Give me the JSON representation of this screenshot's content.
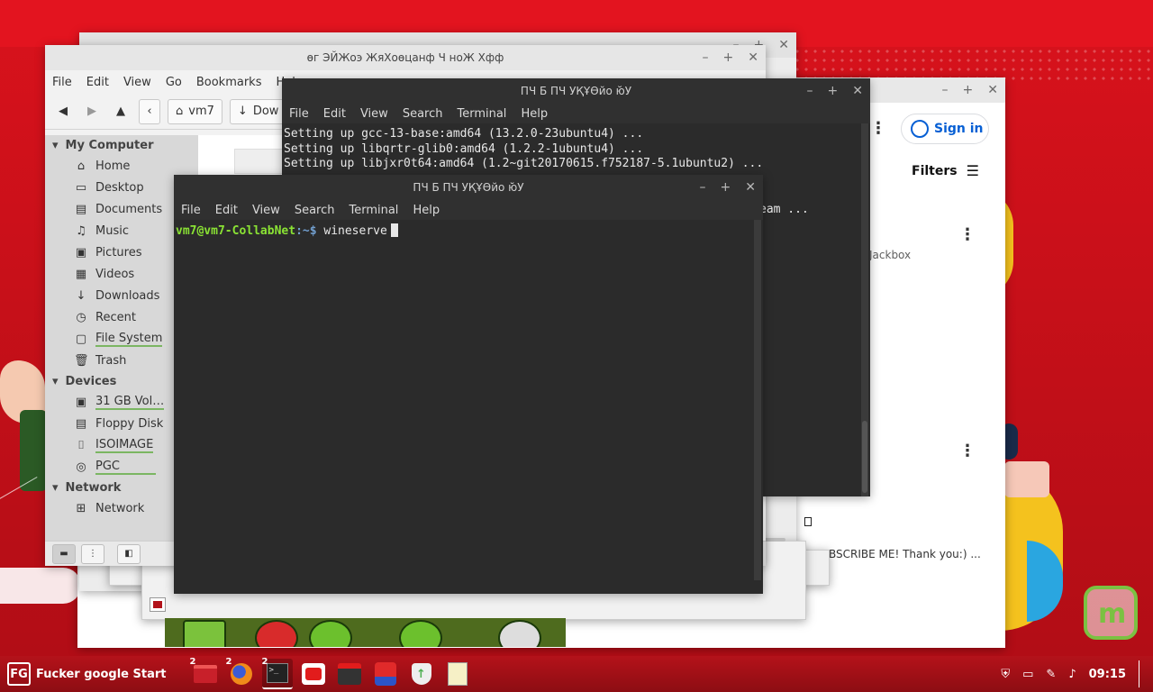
{
  "back_browser": {
    "sign_in": "Sign in",
    "filters": "Filters",
    "snippet_1": "Jackbox",
    "snippet_2": "BSCRIBE ME! Thank you:) ..."
  },
  "file_manager": {
    "title": "өг ЭЙЖоэ ЖяХоөцанф Ч ноЖ Хфф",
    "menu": [
      "File",
      "Edit",
      "View",
      "Go",
      "Bookmarks",
      "Help"
    ],
    "path_current": "vm7",
    "path_next": "Dow",
    "sidebar": {
      "my_computer": "My Computer",
      "computer_items": [
        {
          "label": "Home",
          "icon": "home-icon"
        },
        {
          "label": "Desktop",
          "icon": "desktop-icon"
        },
        {
          "label": "Documents",
          "icon": "documents-icon"
        },
        {
          "label": "Music",
          "icon": "music-icon"
        },
        {
          "label": "Pictures",
          "icon": "pictures-icon"
        },
        {
          "label": "Videos",
          "icon": "videos-icon"
        },
        {
          "label": "Downloads",
          "icon": "downloads-icon"
        },
        {
          "label": "Recent",
          "icon": "recent-icon"
        },
        {
          "label": "File System",
          "icon": "filesystem-icon"
        },
        {
          "label": "Trash",
          "icon": "trash-icon"
        }
      ],
      "devices": "Devices",
      "device_items": [
        {
          "label": "31 GB Vol…",
          "icon": "drive-icon"
        },
        {
          "label": "Floppy Disk",
          "icon": "floppy-icon"
        },
        {
          "label": "ISOIMAGE",
          "icon": "usb-icon"
        },
        {
          "label": "PGC",
          "icon": "disc-icon"
        }
      ],
      "network": "Network",
      "network_items": [
        {
          "label": "Network",
          "icon": "network-icon"
        }
      ]
    }
  },
  "terminal_back": {
    "title": "ПЧ  Б ПЧ    УҚҰӨйо ю̆У",
    "menu": [
      "File",
      "Edit",
      "View",
      "Search",
      "Terminal",
      "Help"
    ],
    "lines": [
      "Setting up gcc-13-base:amd64 (13.2.0-23ubuntu4) ...",
      "Setting up libqrtr-glib0:amd64 (1.2.2-1ubuntu4) ...",
      "Setting up libjxr0t64:amd64 (1.2~git20170615.f752187-5.1ubuntu2) ..."
    ],
    "fragment": "eam ..."
  },
  "terminal_front": {
    "title": "ПЧ  Б ПЧ    УҚҰӨйо ю̆У",
    "menu": [
      "File",
      "Edit",
      "View",
      "Search",
      "Terminal",
      "Help"
    ],
    "prompt_user": "vm7@vm7-CollabNet",
    "prompt_path": ":~$",
    "command": " wineserve"
  },
  "taskbar": {
    "start_label": "Fucker google Start",
    "start_logo": "FG",
    "badges": {
      "files": "2",
      "firefox": "2",
      "terminal": "2"
    },
    "clock": "09:15"
  }
}
